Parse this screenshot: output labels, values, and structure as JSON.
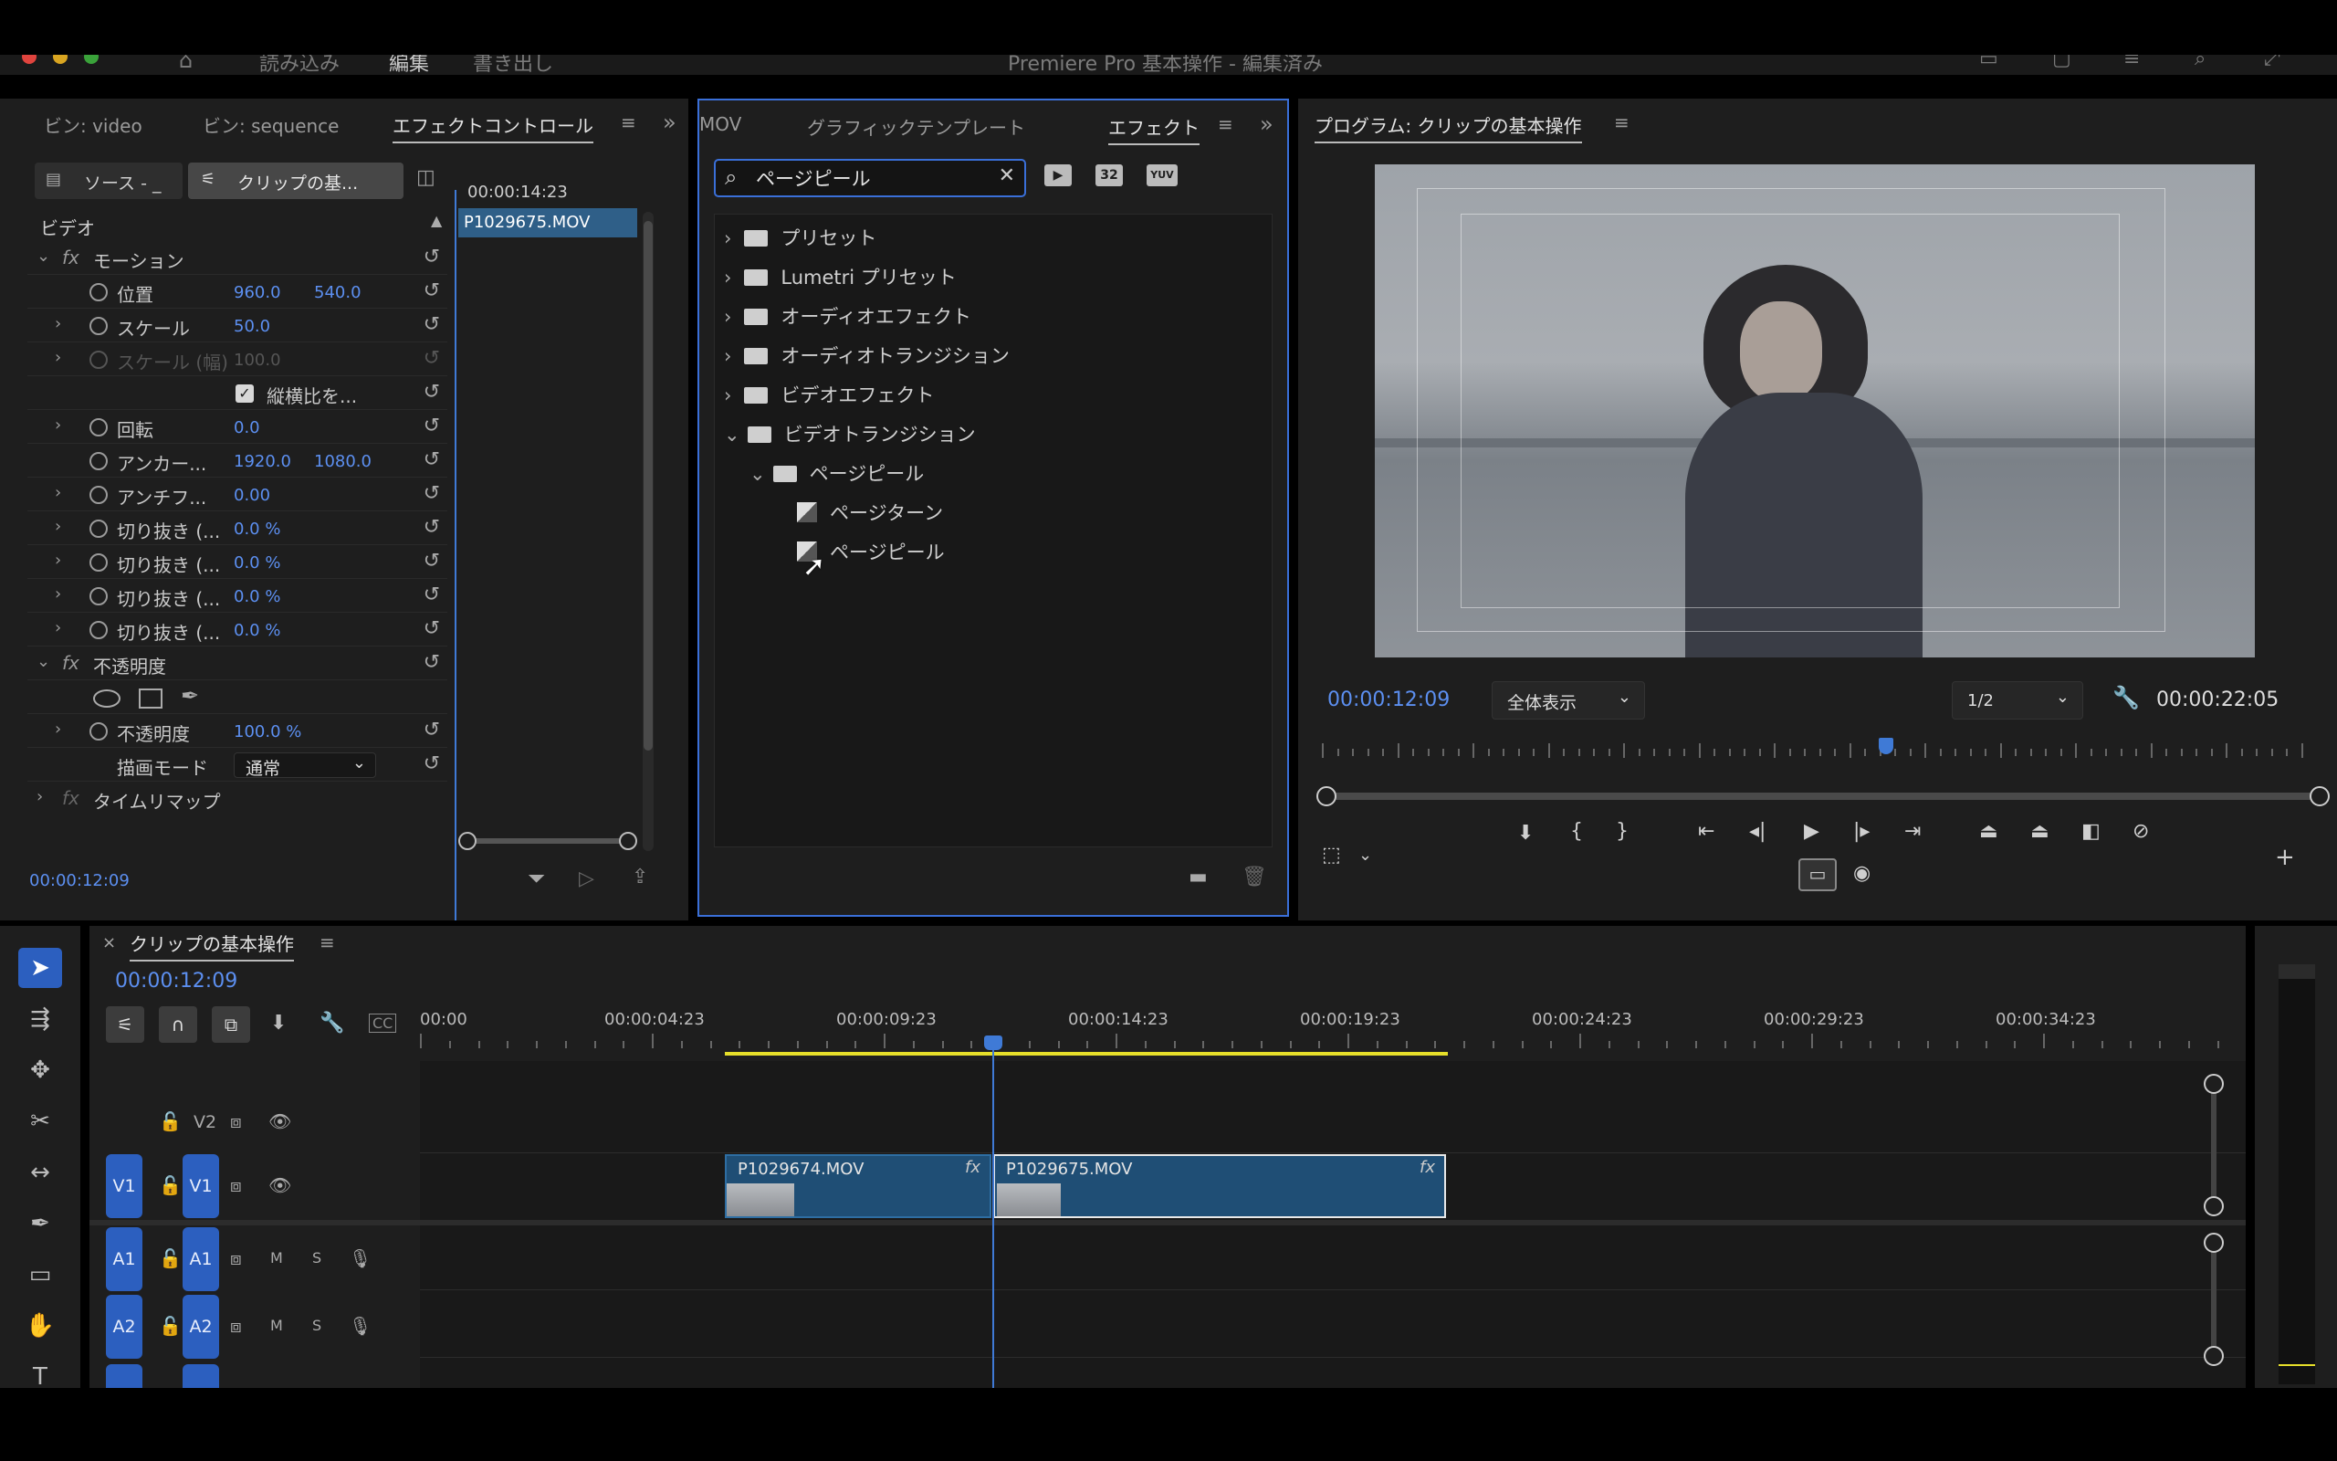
{
  "titlebar": {
    "workspaces": [
      "読み込み",
      "編集",
      "書き出し"
    ],
    "title": "Premiere Pro 基本操作 - 編集済み"
  },
  "effect_controls": {
    "tabs": [
      "ビン: video",
      "ビン: sequence",
      "エフェクトコントロール"
    ],
    "source_button": "ソース - _",
    "clip_button": "クリップの基...",
    "mini_timecode": "00:00:14:23",
    "mini_clip": "P1029675.MOV",
    "section_video": "ビデオ",
    "rows": {
      "motion": "モーション",
      "position": "位置",
      "position_x": "960.0",
      "position_y": "540.0",
      "scale": "スケール",
      "scale_val": "50.0",
      "scale_width": "スケール (幅)",
      "scale_width_val": "100.0",
      "uniform": "縦横比を...",
      "rotation": "回転",
      "rotation_val": "0.0",
      "anchor": "アンカー...",
      "anchor_x": "1920.0",
      "anchor_y": "1080.0",
      "antiflicker": "アンチフ...",
      "antiflicker_val": "0.00",
      "crop1": "切り抜き (...",
      "crop1_val": "0.0 %",
      "crop2": "切り抜き (...",
      "crop2_val": "0.0 %",
      "crop3": "切り抜き (...",
      "crop3_val": "0.0 %",
      "crop4": "切り抜き (...",
      "crop4_val": "0.0 %",
      "opacity_group": "不透明度",
      "opacity": "不透明度",
      "opacity_val": "100.0 %",
      "blend": "描画モード",
      "blend_val": "通常",
      "timeremap": "タイムリマップ"
    },
    "timecode": "00:00:12:09"
  },
  "effects_panel": {
    "tabs": [
      "MOV",
      "グラフィックテンプレート",
      "エフェクト"
    ],
    "search_value": "ページピール",
    "badges": [
      "32",
      "YUV"
    ],
    "tree": {
      "presets": "プリセット",
      "lumetri": "Lumetri プリセット",
      "audio_fx": "オーディオエフェクト",
      "audio_tr": "オーディオトランジション",
      "video_fx": "ビデオエフェクト",
      "video_tr": "ビデオトランジション",
      "pagepeel_folder": "ページピール",
      "page_turn": "ページターン",
      "page_peel": "ページピール"
    }
  },
  "program": {
    "title": "プログラム: クリップの基本操作",
    "timecode": "00:00:12:09",
    "fit": "全体表示",
    "resolution": "1/2",
    "duration": "00:00:22:05",
    "playhead_fraction": 0.56
  },
  "timeline": {
    "sequence": "クリップの基本操作",
    "timecode": "00:00:12:09",
    "ruler": [
      "00:00",
      "00:00:04:23",
      "00:00:09:23",
      "00:00:14:23",
      "00:00:19:23",
      "00:00:24:23",
      "00:00:29:23",
      "00:00:34:23"
    ],
    "tracks": {
      "v2": "V2",
      "v1_src": "V1",
      "v1": "V1",
      "a1_src": "A1",
      "a1": "A1",
      "a2_src": "A2",
      "a2": "A2",
      "m": "M",
      "s": "S"
    },
    "clips": [
      "P1029674.MOV",
      "P1029675.MOV"
    ],
    "fx": "fx"
  },
  "colors": {
    "accent": "#5c8ff0",
    "track_button": "#2c5fbf",
    "clip": "#1f4e75",
    "work_area": "#e6df2a"
  }
}
